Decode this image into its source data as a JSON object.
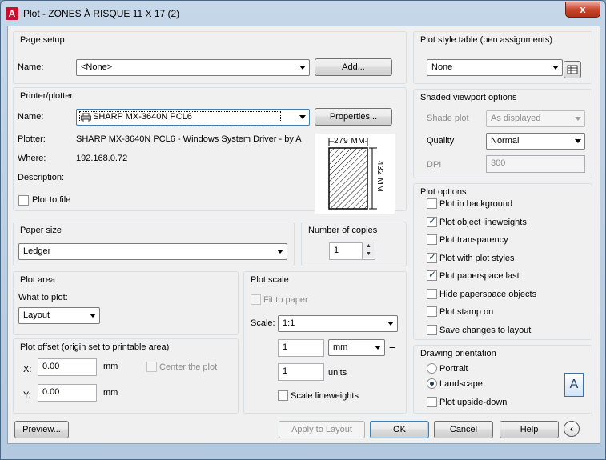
{
  "window": {
    "title": "Plot - ZONES À RISQUE 11 X 17 (2)",
    "close_label": "x"
  },
  "page_setup": {
    "title": "Page setup",
    "name_label": "Name:",
    "name_value": "<None>",
    "add_label": "Add..."
  },
  "printer": {
    "title": "Printer/plotter",
    "name_label": "Name:",
    "name_value": "SHARP MX-3640N PCL6",
    "properties_label": "Properties...",
    "plotter_label": "Plotter:",
    "plotter_value": "SHARP MX-3640N PCL6 - Windows System Driver - by A...",
    "where_label": "Where:",
    "where_value": "192.168.0.72",
    "description_label": "Description:",
    "plot_to_file_label": "Plot to file",
    "preview_width": "279 MM",
    "preview_height": "432 MM"
  },
  "paper_size": {
    "title": "Paper size",
    "value": "Ledger"
  },
  "copies": {
    "title": "Number of copies",
    "value": "1"
  },
  "plot_area": {
    "title": "Plot area",
    "what_label": "What to plot:",
    "what_value": "Layout"
  },
  "plot_offset": {
    "title": "Plot offset (origin set to printable area)",
    "x_label": "X:",
    "x_value": "0.00",
    "x_unit": "mm",
    "y_label": "Y:",
    "y_value": "0.00",
    "y_unit": "mm",
    "center_label": "Center the plot"
  },
  "plot_scale": {
    "title": "Plot scale",
    "fit_label": "Fit to paper",
    "scale_label": "Scale:",
    "scale_value": "1:1",
    "value1": "1",
    "unit1": "mm",
    "equals": "=",
    "value2": "1",
    "unit2": "units",
    "lineweights_label": "Scale lineweights"
  },
  "plot_style": {
    "title": "Plot style table (pen assignments)",
    "value": "None"
  },
  "shaded": {
    "title": "Shaded viewport options",
    "shade_label": "Shade plot",
    "shade_value": "As displayed",
    "quality_label": "Quality",
    "quality_value": "Normal",
    "dpi_label": "DPI",
    "dpi_value": "300"
  },
  "plot_options": {
    "title": "Plot options",
    "items": [
      {
        "label": "Plot in background",
        "checked": false
      },
      {
        "label": "Plot object lineweights",
        "checked": true
      },
      {
        "label": "Plot transparency",
        "checked": false
      },
      {
        "label": "Plot with plot styles",
        "checked": true
      },
      {
        "label": "Plot paperspace last",
        "checked": true
      },
      {
        "label": "Hide paperspace objects",
        "checked": false
      },
      {
        "label": "Plot stamp on",
        "checked": false
      },
      {
        "label": "Save changes to layout",
        "checked": false
      }
    ]
  },
  "orientation": {
    "title": "Drawing orientation",
    "portrait_label": "Portrait",
    "landscape_label": "Landscape",
    "upside_label": "Plot upside-down",
    "icon_letter": "A"
  },
  "footer": {
    "preview_label": "Preview...",
    "apply_label": "Apply to Layout",
    "ok_label": "OK",
    "cancel_label": "Cancel",
    "help_label": "Help",
    "more_icon": "‹"
  }
}
